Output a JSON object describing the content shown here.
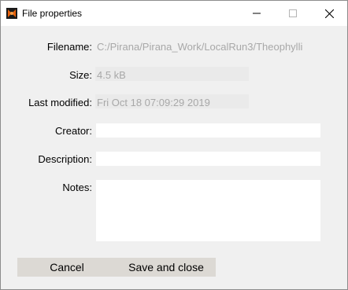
{
  "window": {
    "title": "File properties",
    "icon": "pirana-app-icon",
    "controls": {
      "minimize": "minimize-icon",
      "maximize": "maximize-icon",
      "close": "close-icon"
    }
  },
  "form": {
    "filename": {
      "label": "Filename:",
      "value": "C:/Pirana/Pirana_Work/LocalRun3/Theophylli"
    },
    "size": {
      "label": "Size:",
      "value": "4.5 kB"
    },
    "last_modified": {
      "label": "Last modified:",
      "value": "Fri Oct 18 07:09:29 2019"
    },
    "creator": {
      "label": "Creator:",
      "value": ""
    },
    "description": {
      "label": "Description:",
      "value": ""
    },
    "notes": {
      "label": "Notes:",
      "value": ""
    }
  },
  "buttons": {
    "cancel": "Cancel",
    "save_and_close": "Save and close"
  },
  "colors": {
    "window_bg": "#f0f0f0",
    "titlebar_bg": "#ffffff",
    "readonly_text": "#a8a8a8",
    "button_bar_bg": "#dcd9d4",
    "app_icon_orange": "#e8620c"
  }
}
